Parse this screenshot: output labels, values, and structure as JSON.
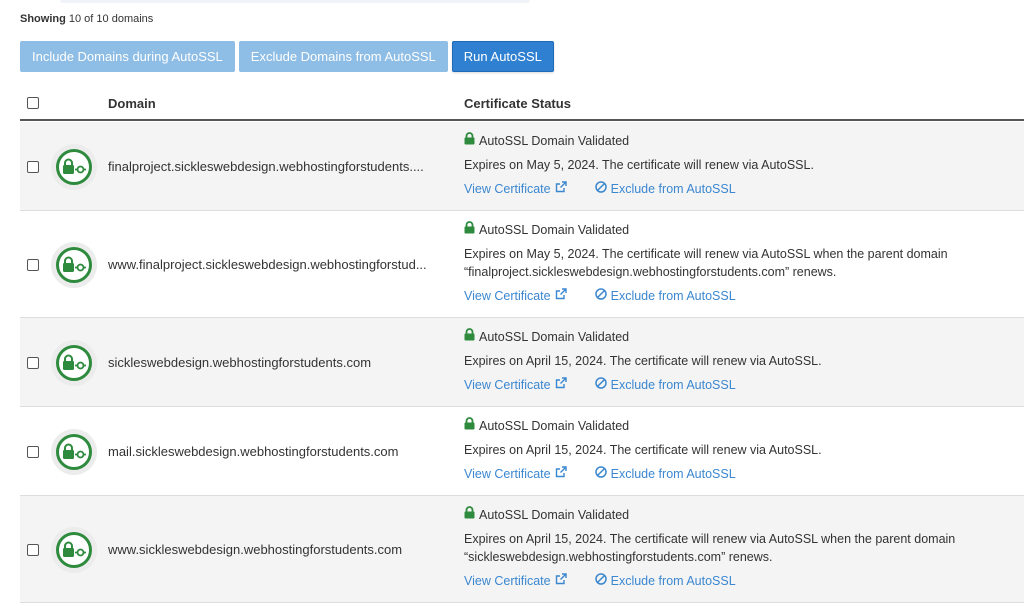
{
  "summary": {
    "showing_label": "Showing",
    "showing_text": "10 of 10 domains"
  },
  "toolbar": {
    "include_label": "Include Domains during AutoSSL",
    "exclude_label": "Exclude Domains from AutoSSL",
    "run_label": "Run AutoSSL"
  },
  "table": {
    "headers": {
      "domain": "Domain",
      "status": "Certificate Status"
    },
    "rows": [
      {
        "domain": "finalproject.sickleswebdesign.webhostingforstudents....",
        "status": "AutoSSL Domain Validated",
        "expires": "Expires on May 5, 2024. The certificate will renew via AutoSSL.",
        "view": "View Certificate",
        "exclude": "Exclude from AutoSSL"
      },
      {
        "domain": "www.finalproject.sickleswebdesign.webhostingforstud...",
        "status": "AutoSSL Domain Validated",
        "expires": "Expires on May 5, 2024. The certificate will renew via AutoSSL when the parent domain “finalproject.sickleswebdesign.webhostingforstudents.com” renews.",
        "view": "View Certificate",
        "exclude": "Exclude from AutoSSL"
      },
      {
        "domain": "sickleswebdesign.webhostingforstudents.com",
        "status": "AutoSSL Domain Validated",
        "expires": "Expires on April 15, 2024. The certificate will renew via AutoSSL.",
        "view": "View Certificate",
        "exclude": "Exclude from AutoSSL"
      },
      {
        "domain": "mail.sickleswebdesign.webhostingforstudents.com",
        "status": "AutoSSL Domain Validated",
        "expires": "Expires on April 15, 2024. The certificate will renew via AutoSSL.",
        "view": "View Certificate",
        "exclude": "Exclude from AutoSSL"
      },
      {
        "domain": "www.sickleswebdesign.webhostingforstudents.com",
        "status": "AutoSSL Domain Validated",
        "expires": "Expires on April 15, 2024. The certificate will renew via AutoSSL when the parent domain “sickleswebdesign.webhostingforstudents.com” renews.",
        "view": "View Certificate",
        "exclude": "Exclude from AutoSSL"
      }
    ]
  },
  "icons": {
    "status": "ssl-validated-lock-icon",
    "lock": "lock-icon",
    "external": "external-link-icon",
    "exclude": "ban-icon"
  },
  "colors": {
    "accent": "#2f80d1",
    "accent_light": "#8ebde6",
    "success": "#2e8b3e",
    "link": "#3b87d0"
  }
}
